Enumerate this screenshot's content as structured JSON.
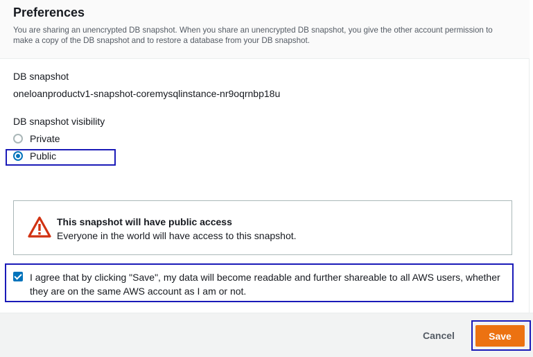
{
  "header": {
    "title": "Preferences",
    "description": "You are sharing an unencrypted DB snapshot. When you share an unencrypted DB snapshot, you give the other account permission to make a copy of the DB snapshot and to restore a database from your DB snapshot."
  },
  "snapshot": {
    "label": "DB snapshot",
    "value": "oneloanproductv1-snapshot-coremysqlinstance-nr9oqrnbp18u"
  },
  "visibility": {
    "label": "DB snapshot visibility",
    "options": [
      {
        "label": "Private",
        "checked": false
      },
      {
        "label": "Public",
        "checked": true
      }
    ]
  },
  "alert": {
    "icon": "warning-icon",
    "color": "#d13212",
    "title": "This snapshot will have public access",
    "text": "Everyone in the world will have access to this snapshot."
  },
  "agreement": {
    "checked": true,
    "text": "I agree that by clicking \"Save\", my data will become readable and further shareable to all AWS users, whether they are on the same AWS account as I am or not."
  },
  "footer": {
    "cancel_label": "Cancel",
    "save_label": "Save"
  },
  "colors": {
    "accent": "#0073bb",
    "primary_button": "#ec7211",
    "highlight_box": "#1a1ab8"
  }
}
